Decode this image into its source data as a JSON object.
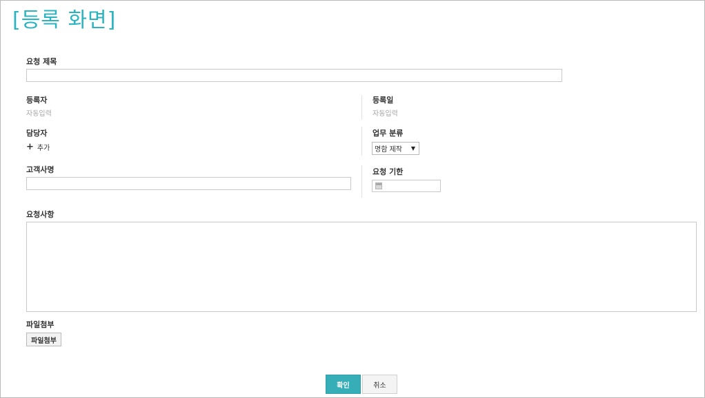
{
  "page": {
    "title": "[등록 화면]"
  },
  "form": {
    "request_title": {
      "label": "요청 제목",
      "value": ""
    },
    "registrant": {
      "label": "등록자",
      "value": "자동입력"
    },
    "registered_date": {
      "label": "등록일",
      "value": "자동입력"
    },
    "assignee": {
      "label": "담당자",
      "add_label": "추가"
    },
    "work_category": {
      "label": "업무 분류",
      "selected": "명함 제작"
    },
    "customer_company": {
      "label": "고객사명",
      "value": ""
    },
    "request_deadline": {
      "label": "요청 기한",
      "value": ""
    },
    "request_details": {
      "label": "요청사항",
      "value": ""
    },
    "attachment": {
      "label": "파일첨부",
      "button_label": "파일첨부"
    }
  },
  "actions": {
    "confirm_label": "확인",
    "cancel_label": "취소"
  },
  "colors": {
    "accent": "#2ab4c0",
    "confirm_button": "#36aeb7"
  }
}
